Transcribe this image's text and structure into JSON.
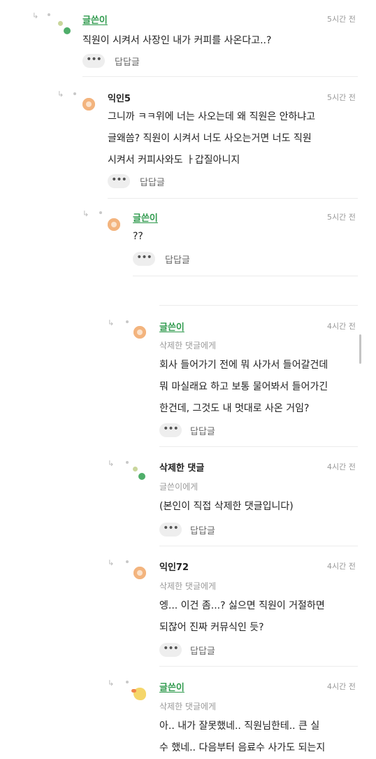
{
  "comments": [
    {
      "name": "글쓴이",
      "time": "5시간 전",
      "target": "",
      "lines": [
        "직원이 시켜서 사장인 내가 커피를 사온다고..?"
      ],
      "more": "•••",
      "reply": "답답글"
    },
    {
      "name": "익인5",
      "time": "5시간 전",
      "target": "",
      "lines": [
        "그니까 ㅋㅋ위에 너는 사오는데 왜 직원은 안하냐고",
        "글왜씀? 직원이 시켜서 너도 사오는거면 너도 직원",
        "시켜서 커피사와도 ㅏ갑질아니지"
      ],
      "more": "•••",
      "reply": "답답글"
    },
    {
      "name": "글쓴이",
      "time": "5시간 전",
      "target": "",
      "lines": [
        "??"
      ],
      "more": "•••",
      "reply": "답답글"
    },
    {
      "name": "글쓴이",
      "time": "4시간 전",
      "target": "삭제한 댓글에게",
      "lines": [
        "회사 들어가기 전에 뭐 사가서 들어갈건데",
        "뭐 마실래요 하고 보통 물어봐서 들어가긴",
        "한건데, 그것도 내 멋대로 사온 거임?"
      ],
      "more": "•••",
      "reply": "답답글"
    },
    {
      "name": "삭제한 댓글",
      "time": "4시간 전",
      "target": "글쓴이에게",
      "lines": [
        "(본인이 직접 삭제한 댓글입니다)"
      ],
      "more": "•••",
      "reply": "답답글"
    },
    {
      "name": "익인72",
      "time": "4시간 전",
      "target": "삭제한 댓글에게",
      "lines": [
        "엥... 이건 좀...? 싫으면 직원이 거절하면",
        "되잖어 진짜 커뮤식인 듯?"
      ],
      "more": "•••",
      "reply": "답답글"
    },
    {
      "name": "글쓴이",
      "time": "4시간 전",
      "target": "삭제한 댓글에게",
      "lines": [
        "아.. 내가 잘못했네.. 직원님한테.. 큰 실",
        "수 했네.. 다음부터 음료수 사가도 되는지"
      ],
      "more": "",
      "reply": ""
    }
  ],
  "icons": {
    "reply_arrow": "reply-arrow-icon",
    "more": "more-dots-icon"
  },
  "colors": {
    "writer_name": "#2f9a4d",
    "meta_gray": "#9a9a9a",
    "avatar_orange": "#f3b47e",
    "avatar_green": "#4fae6a"
  }
}
